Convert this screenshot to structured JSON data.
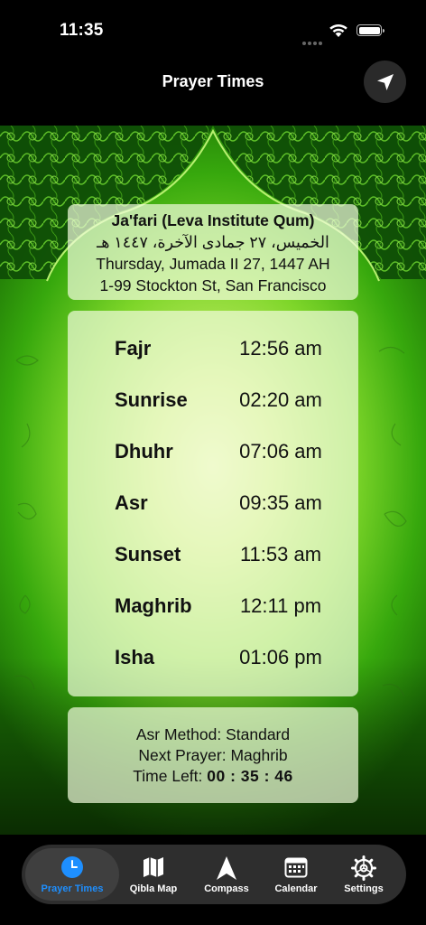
{
  "status_bar": {
    "time": "11:35"
  },
  "nav": {
    "title": "Prayer Times",
    "location_icon": "location-arrow-icon"
  },
  "header": {
    "method": "Ja'fari (Leva Institute Qum)",
    "hijri_arabic": "الخميس، ٢٧ جمادى الآخرة، ١٤٤٧ هـ",
    "date": "Thursday, Jumada II 27, 1447 AH",
    "location": "1-99 Stockton St, San Francisco"
  },
  "prayers": [
    {
      "name": "Fajr",
      "time": "12:56 am"
    },
    {
      "name": "Sunrise",
      "time": "02:20 am"
    },
    {
      "name": "Dhuhr",
      "time": "07:06 am"
    },
    {
      "name": "Asr",
      "time": "09:35 am"
    },
    {
      "name": "Sunset",
      "time": "11:53 am"
    },
    {
      "name": "Maghrib",
      "time": "12:11 pm"
    },
    {
      "name": "Isha",
      "time": "01:06 pm"
    }
  ],
  "info": {
    "asr_method": "Asr Method: Standard",
    "next_prayer": "Next Prayer: Maghrib",
    "time_left_label": "Time Left:",
    "time_left_value": "00 : 35 : 46"
  },
  "tabs": [
    {
      "label": "Prayer Times",
      "icon": "clock-icon",
      "active": true
    },
    {
      "label": "Qibla Map",
      "icon": "map-icon",
      "active": false
    },
    {
      "label": "Compass",
      "icon": "compass-arrow-icon",
      "active": false
    },
    {
      "label": "Calendar",
      "icon": "calendar-icon",
      "active": false
    },
    {
      "label": "Settings",
      "icon": "gear-icon",
      "active": false
    }
  ],
  "colors": {
    "accent": "#1e8fff",
    "background_green": "#37a80d",
    "card_tint": "#f2fcde"
  }
}
